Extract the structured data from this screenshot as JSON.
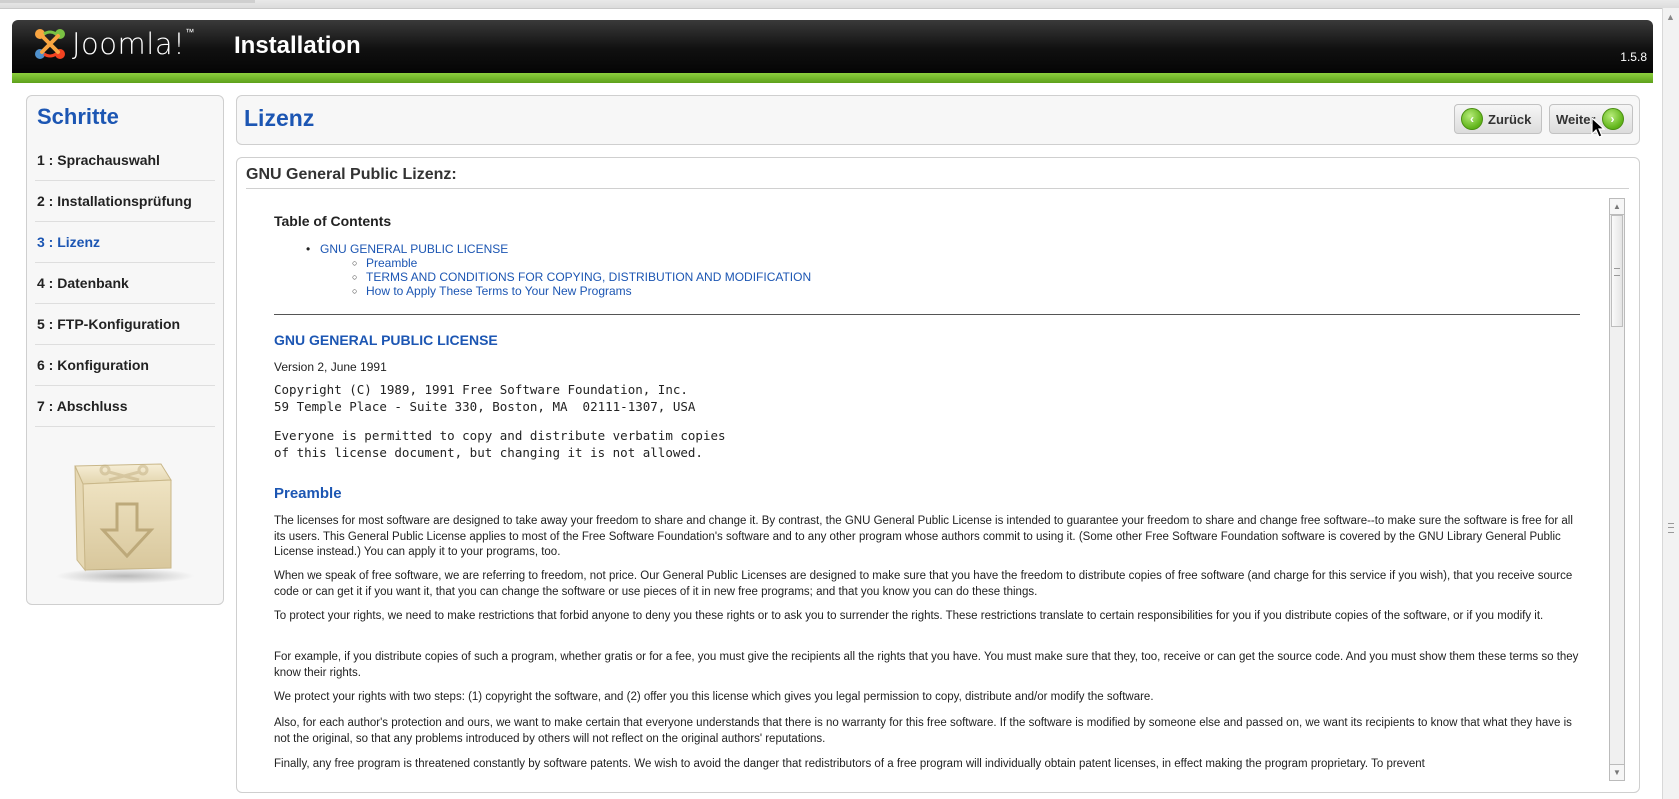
{
  "header": {
    "logo_text": "Joomla!",
    "logo_tm": "™",
    "title": "Installation",
    "version": "1.5.8"
  },
  "sidebar": {
    "title": "Schritte",
    "steps": [
      {
        "label": "1 : Sprachauswahl",
        "active": false
      },
      {
        "label": "2 : Installationsprüfung",
        "active": false
      },
      {
        "label": "3 : Lizenz",
        "active": true
      },
      {
        "label": "4 : Datenbank",
        "active": false
      },
      {
        "label": "5 : FTP-Konfiguration",
        "active": false
      },
      {
        "label": "6 : Konfiguration",
        "active": false
      },
      {
        "label": "7 : Abschluss",
        "active": false
      }
    ]
  },
  "toolbar": {
    "page_title": "Lizenz",
    "back_label": "Zurück",
    "next_label": "Weiter"
  },
  "license": {
    "panel_title": "GNU General Public Lizenz:",
    "toc_title": "Table of Contents",
    "toc": {
      "main": "GNU GENERAL PUBLIC LICENSE",
      "items": [
        "Preamble",
        "TERMS AND CONDITIONS FOR COPYING, DISTRIBUTION AND MODIFICATION",
        "How to Apply These Terms to Your New Programs"
      ]
    },
    "heading": "GNU GENERAL PUBLIC LICENSE",
    "version_line": "Version 2, June 1991",
    "copyright_block": "Copyright (C) 1989, 1991 Free Software Foundation, Inc.\n59 Temple Place - Suite 330, Boston, MA  02111-1307, USA",
    "permission_block": "Everyone is permitted to copy and distribute verbatim copies\nof this license document, but changing it is not allowed.",
    "preamble_heading": "Preamble",
    "paragraphs": [
      "The licenses for most software are designed to take away your freedom to share and change it. By contrast, the GNU General Public License is intended to guarantee your freedom to share and change free software--to make sure the software is free for all its users. This General Public License applies to most of the Free Software Foundation's software and to any other program whose authors commit to using it. (Some other Free Software Foundation software is covered by the GNU Library General Public License instead.) You can apply it to your programs, too.",
      "When we speak of free software, we are referring to freedom, not price. Our General Public Licenses are designed to make sure that you have the freedom to distribute copies of free software (and charge for this service if you wish), that you receive source code or can get it if you want it, that you can change the software or use pieces of it in new free programs; and that you know you can do these things.",
      "To protect your rights, we need to make restrictions that forbid anyone to deny you these rights or to ask you to surrender the rights. These restrictions translate to certain responsibilities for you if you distribute copies of the software, or if you modify it.",
      "For example, if you distribute copies of such a program, whether gratis or for a fee, you must give the recipients all the rights that you have. You must make sure that they, too, receive or can get the source code. And you must show them these terms so they know their rights.",
      "We protect your rights with two steps: (1) copyright the software, and (2) offer you this license which gives you legal permission to copy, distribute and/or modify the software.",
      "Also, for each author's protection and ours, we want to make certain that everyone understands that there is no warranty for this free software. If the software is modified by someone else and passed on, we want its recipients to know that what they have is not the original, so that any problems introduced by others will not reflect on the original authors' reputations.",
      "Finally, any free program is threatened constantly by software patents. We wish to avoid the danger that redistributors of a free program will individually obtain patent licenses, in effect making the program proprietary. To prevent"
    ]
  },
  "colors": {
    "accent_blue": "#1c56b3",
    "header_green": "#6fb52c",
    "header_black": "#000000"
  }
}
